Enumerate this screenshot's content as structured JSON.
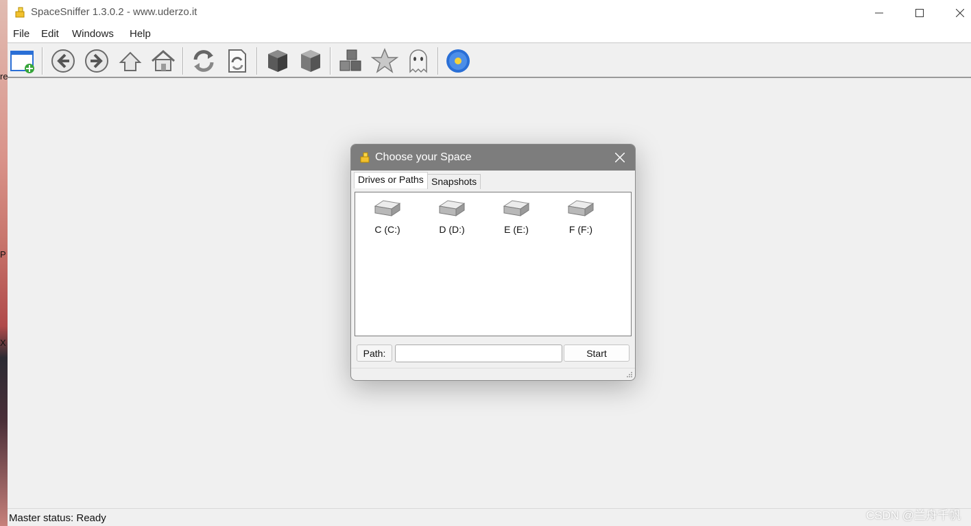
{
  "window": {
    "title": "SpaceSniffer 1.3.0.2 - www.uderzo.it",
    "buttons": {
      "minimize": "—",
      "maximize": "☐",
      "close": "✕"
    }
  },
  "menu": {
    "file": "File",
    "edit": "Edit",
    "windows": "Windows",
    "help": "Help"
  },
  "toolbar": {
    "icons": [
      "new-space-icon",
      "back-icon",
      "forward-icon",
      "up-icon",
      "home-icon",
      "refresh-icon",
      "refresh-document-icon",
      "box-icon",
      "box-open-icon",
      "blocks-icon",
      "star-icon",
      "ghost-icon",
      "settings-flower-icon"
    ]
  },
  "desktop_fragments": {
    "a": "re",
    "b": "P",
    "c": "X"
  },
  "status": {
    "text": "Master status: Ready"
  },
  "watermark": "CSDN @兰舟千帆",
  "dialog": {
    "title": "Choose your Space",
    "tabs": {
      "drives": "Drives or Paths",
      "snapshots": "Snapshots"
    },
    "drives": [
      {
        "label": "C (C:)"
      },
      {
        "label": "D (D:)"
      },
      {
        "label": "E (E:)"
      },
      {
        "label": "F (F:)"
      }
    ],
    "path_label": "Path:",
    "path_value": "",
    "start_label": "Start"
  },
  "colors": {
    "dialog_title_bg": "#7d7d7d",
    "app_bg": "#f0f0f0",
    "accent_green": "#37a53b",
    "accent_blue": "#2a6fd6"
  }
}
